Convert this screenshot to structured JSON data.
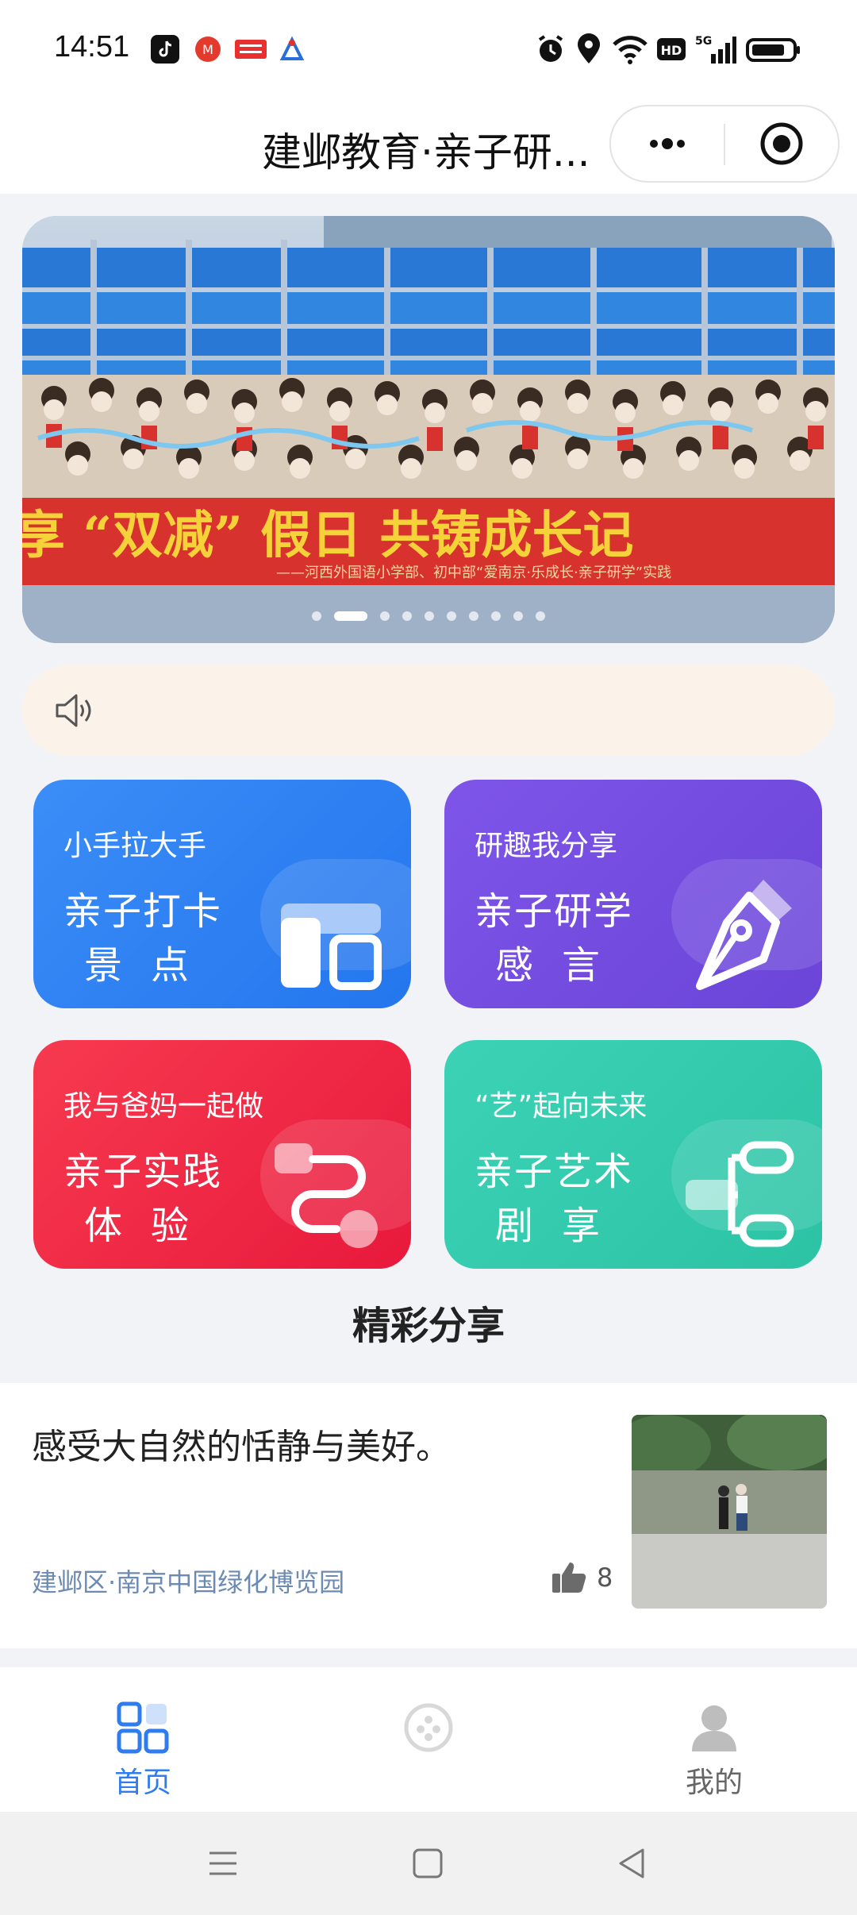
{
  "status_bar": {
    "time": "14:51",
    "apps": [
      "tiktok-icon",
      "m-app-icon",
      "toutiao-icon",
      "navi-icon"
    ],
    "right_icons": [
      "alarm-icon",
      "location-icon",
      "wifi-icon",
      "hd-icon",
      "5g-signal-icon",
      "battery-icon"
    ],
    "hd_label": "HD",
    "network_label": "5G"
  },
  "header": {
    "title": "建邺教育·亲子研...",
    "more_icon": "more-dots-icon",
    "close_icon": "mini-program-close-icon"
  },
  "banner": {
    "slogan": "享 “双减” 假日 共铸成长记",
    "caption": "——河西外国语小学部、初中部“爱南京·乐成长·亲子研学”实践",
    "page_count": 10,
    "active_index": 1
  },
  "notice": {
    "icon": "speaker-icon",
    "text": ""
  },
  "cards": [
    {
      "sub": "小手拉大手",
      "main": "亲子打卡",
      "main2": "景点",
      "icon": "layout-panels-icon",
      "color": "#2f83f3"
    },
    {
      "sub": "研趣我分享",
      "main": "亲子研学",
      "main2": "感言",
      "icon": "pen-nib-icon",
      "color": "#744ce0"
    },
    {
      "sub": "我与爸妈一起做",
      "main": "亲子实践",
      "main2": "体验",
      "icon": "flow-path-icon",
      "color": "#f0283f"
    },
    {
      "sub": "“艺”起向未来",
      "main": "亲子艺术",
      "main2": "剧享",
      "icon": "mind-map-icon",
      "color": "#33caae"
    }
  ],
  "section_title": "精彩分享",
  "share": {
    "text": "感受大自然的恬静与美好。",
    "location": "建邺区·南京中国绿化博览园",
    "likes": "8",
    "like_icon": "thumbs-up-icon",
    "thumbnail": "park-photo"
  },
  "tabbar": {
    "tabs": [
      {
        "label": "首页",
        "icon": "home-grid-icon",
        "active": true
      },
      {
        "label": "",
        "icon": "center-circle-icon",
        "active": false
      },
      {
        "label": "我的",
        "icon": "profile-icon",
        "active": false
      }
    ]
  },
  "navbar": {
    "buttons": [
      "menu-icon",
      "home-square-icon",
      "back-triangle-icon"
    ]
  }
}
